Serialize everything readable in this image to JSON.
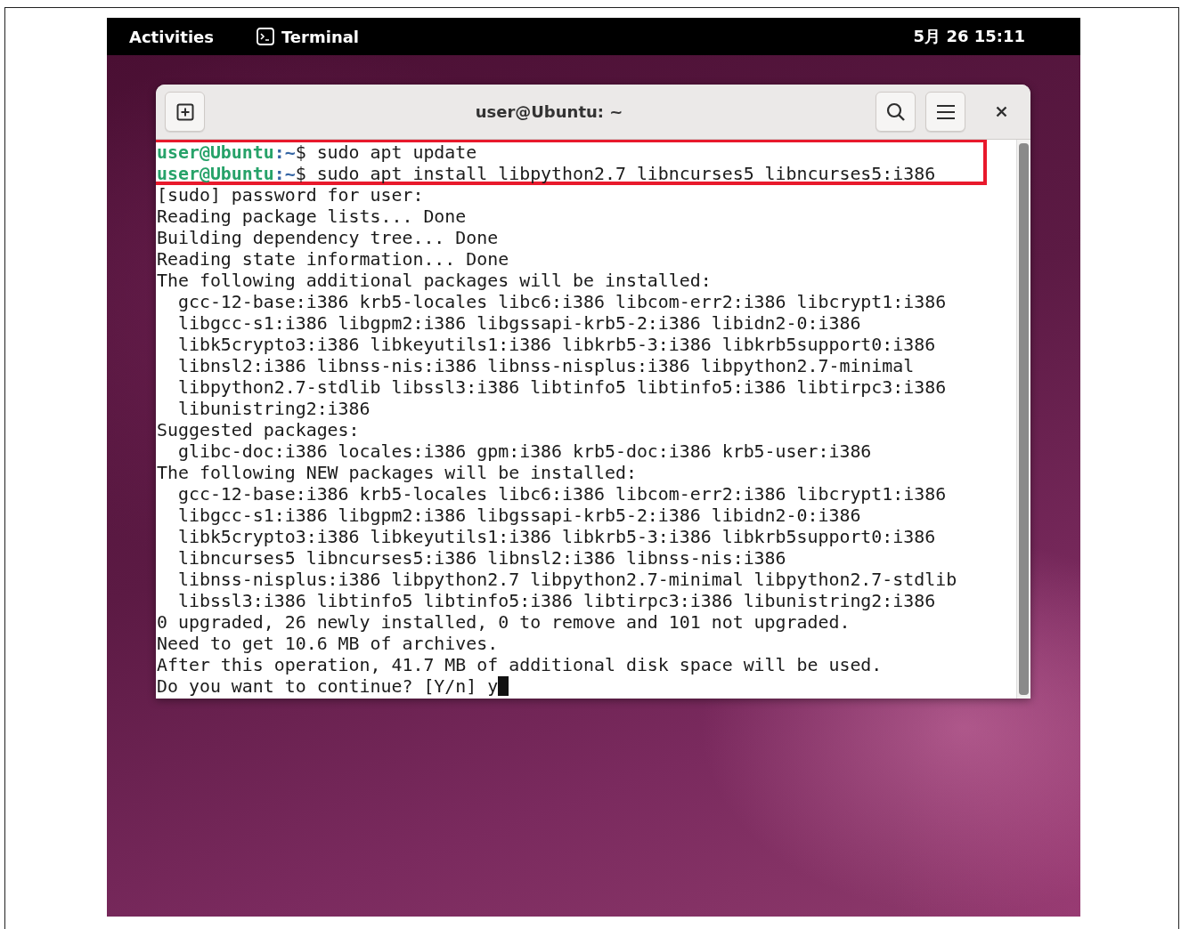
{
  "top_bar": {
    "activities": "Activities",
    "app_name": "Terminal",
    "clock": "5月 26 15:11"
  },
  "window": {
    "title": "user@Ubuntu: ~"
  },
  "terminal": {
    "cursor_visible": true,
    "lines": [
      {
        "kind": "prompt",
        "user_host": "user@Ubuntu",
        "path": ":~",
        "command": "$ sudo apt update",
        "highlighted": true
      },
      {
        "kind": "prompt",
        "user_host": "user@Ubuntu",
        "path": ":~",
        "command": "$ sudo apt install libpython2.7 libncurses5 libncurses5:i386",
        "highlighted": true
      },
      {
        "kind": "output",
        "text": "[sudo] password for user:",
        "highlighted": false
      },
      {
        "kind": "output",
        "text": "Reading package lists... Done",
        "highlighted": false
      },
      {
        "kind": "output",
        "text": "Building dependency tree... Done",
        "highlighted": false
      },
      {
        "kind": "output",
        "text": "Reading state information... Done",
        "highlighted": false
      },
      {
        "kind": "output",
        "text": "The following additional packages will be installed:",
        "highlighted": false
      },
      {
        "kind": "output",
        "text": "  gcc-12-base:i386 krb5-locales libc6:i386 libcom-err2:i386 libcrypt1:i386",
        "highlighted": false
      },
      {
        "kind": "output",
        "text": "  libgcc-s1:i386 libgpm2:i386 libgssapi-krb5-2:i386 libidn2-0:i386",
        "highlighted": false
      },
      {
        "kind": "output",
        "text": "  libk5crypto3:i386 libkeyutils1:i386 libkrb5-3:i386 libkrb5support0:i386",
        "highlighted": false
      },
      {
        "kind": "output",
        "text": "  libnsl2:i386 libnss-nis:i386 libnss-nisplus:i386 libpython2.7-minimal",
        "highlighted": false
      },
      {
        "kind": "output",
        "text": "  libpython2.7-stdlib libssl3:i386 libtinfo5 libtinfo5:i386 libtirpc3:i386",
        "highlighted": false
      },
      {
        "kind": "output",
        "text": "  libunistring2:i386",
        "highlighted": false
      },
      {
        "kind": "output",
        "text": "Suggested packages:",
        "highlighted": false
      },
      {
        "kind": "output",
        "text": "  glibc-doc:i386 locales:i386 gpm:i386 krb5-doc:i386 krb5-user:i386",
        "highlighted": false
      },
      {
        "kind": "output",
        "text": "The following NEW packages will be installed:",
        "highlighted": false
      },
      {
        "kind": "output",
        "text": "  gcc-12-base:i386 krb5-locales libc6:i386 libcom-err2:i386 libcrypt1:i386",
        "highlighted": false
      },
      {
        "kind": "output",
        "text": "  libgcc-s1:i386 libgpm2:i386 libgssapi-krb5-2:i386 libidn2-0:i386",
        "highlighted": false
      },
      {
        "kind": "output",
        "text": "  libk5crypto3:i386 libkeyutils1:i386 libkrb5-3:i386 libkrb5support0:i386",
        "highlighted": false
      },
      {
        "kind": "output",
        "text": "  libncurses5 libncurses5:i386 libnsl2:i386 libnss-nis:i386",
        "highlighted": false
      },
      {
        "kind": "output",
        "text": "  libnss-nisplus:i386 libpython2.7 libpython2.7-minimal libpython2.7-stdlib",
        "highlighted": false
      },
      {
        "kind": "output",
        "text": "  libssl3:i386 libtinfo5 libtinfo5:i386 libtirpc3:i386 libunistring2:i386",
        "highlighted": false
      },
      {
        "kind": "output",
        "text": "0 upgraded, 26 newly installed, 0 to remove and 101 not upgraded.",
        "highlighted": false
      },
      {
        "kind": "output",
        "text": "Need to get 10.6 MB of archives.",
        "highlighted": false
      },
      {
        "kind": "output",
        "text": "After this operation, 41.7 MB of additional disk space will be used.",
        "highlighted": false
      },
      {
        "kind": "output",
        "text": "Do you want to continue? [Y/n] y",
        "highlighted": false
      }
    ]
  }
}
